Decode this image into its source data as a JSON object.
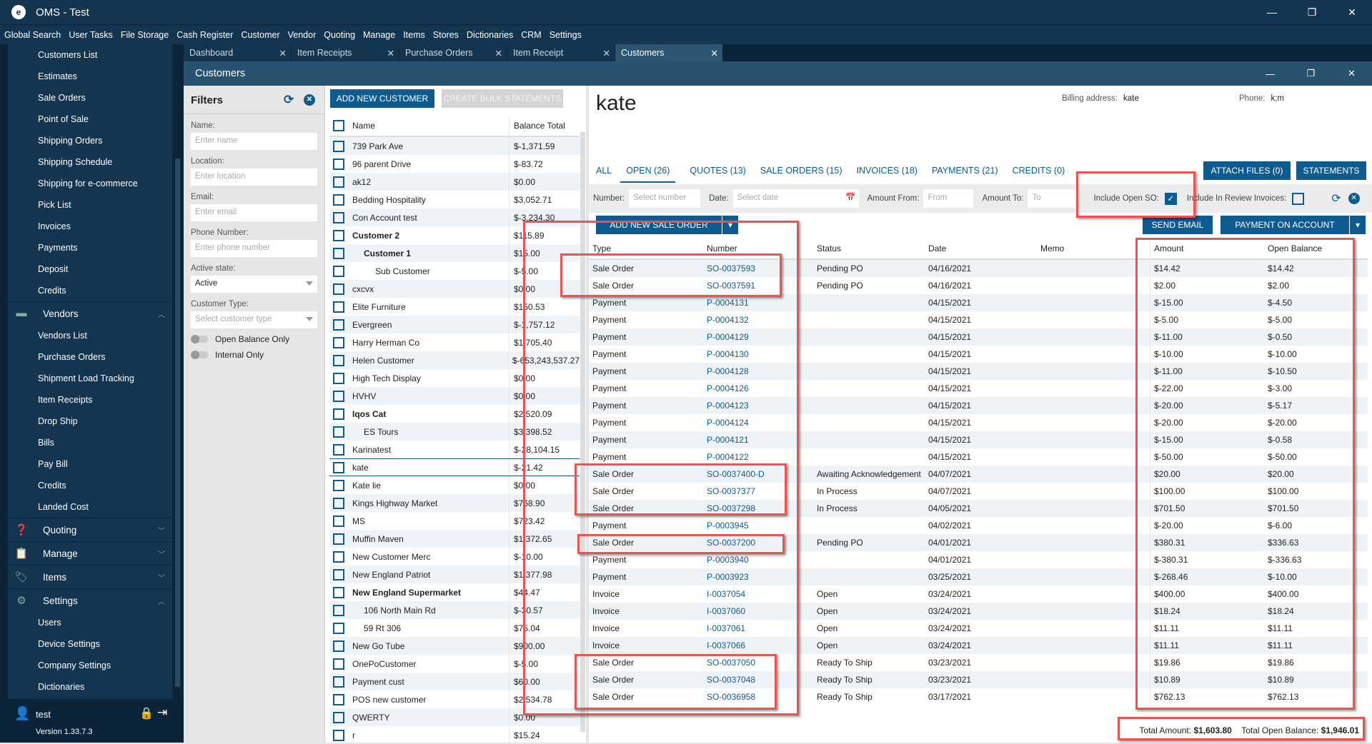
{
  "app": {
    "title": "OMS - Test",
    "controls": [
      "—",
      "❐",
      "✕"
    ]
  },
  "menu": [
    "Global Search",
    "User Tasks",
    "File Storage",
    "Cash Register",
    "Customer",
    "Vendor",
    "Quoting",
    "Manage",
    "Items",
    "Stores",
    "Dictionaries",
    "CRM",
    "Settings"
  ],
  "sidebar": {
    "customer_items": [
      "Customers List",
      "Estimates",
      "Sale Orders",
      "Point of Sale",
      "Shipping Orders",
      "Shipping Schedule",
      "Shipping for e-commerce",
      "Pick List",
      "Invoices",
      "Payments",
      "Deposit",
      "Credits"
    ],
    "vendors": {
      "label": "Vendors",
      "icon": "store-icon",
      "items": [
        "Vendors List",
        "Purchase Orders",
        "Shipment Load Tracking",
        "Item Receipts",
        "Drop Ship",
        "Bills",
        "Pay Bill",
        "Credits",
        "Landed Cost"
      ]
    },
    "groups": [
      {
        "label": "Quoting",
        "icon": "clipboard-question-icon"
      },
      {
        "label": "Manage",
        "icon": "clipboard-list-icon"
      },
      {
        "label": "Items",
        "icon": "tag-icon"
      }
    ],
    "settings": {
      "label": "Settings",
      "icon": "gear-icon",
      "items": [
        "Users",
        "Device Settings",
        "Company Settings",
        "Dictionaries"
      ]
    },
    "user": "test",
    "version": "Version 1.33.7.3"
  },
  "tabs": [
    {
      "label": "Dashboard"
    },
    {
      "label": "Item Receipts"
    },
    {
      "label": "Purchase Orders"
    },
    {
      "label": "Item Receipt"
    },
    {
      "label": "Customers",
      "active": true
    }
  ],
  "window_title": "Customers",
  "filters": {
    "title": "Filters",
    "name_label": "Name:",
    "name_ph": "Enter name",
    "location_label": "Location:",
    "location_ph": "Enter location",
    "email_label": "Email:",
    "email_ph": "Enter email",
    "phone_label": "Phone Number:",
    "phone_ph": "Enter phone number",
    "active_label": "Active state:",
    "active_value": "Active",
    "type_label": "Customer Type:",
    "type_ph": "Select customer type",
    "open_balance": "Open Balance Only",
    "internal": "Internal Only"
  },
  "customers": {
    "add": "ADD NEW CUSTOMER",
    "bulk": "CREATE BULK STATEMENTS",
    "col_name": "Name",
    "col_balance": "Balance Total",
    "rows": [
      [
        "739 Park Ave",
        "$-1,371.59",
        0,
        0
      ],
      [
        "96 parent Drive",
        "$-83.72",
        0,
        0
      ],
      [
        "ak12",
        "$0.00",
        0,
        0
      ],
      [
        "Bedding Hospitality",
        "$3,052.71",
        0,
        0
      ],
      [
        "Con Account test",
        "$-3,234.30",
        0,
        0
      ],
      [
        "Customer 2",
        "$115.89",
        0,
        1
      ],
      [
        "Customer 1",
        "$15.00",
        1,
        1
      ],
      [
        "Sub Customer",
        "$-5.00",
        2,
        0
      ],
      [
        "cxcvx",
        "$0.00",
        0,
        0
      ],
      [
        "Elite Furniture",
        "$150.53",
        0,
        0
      ],
      [
        "Evergreen",
        "$-1,757.12",
        0,
        0
      ],
      [
        "Harry Herman Co",
        "$1,705.40",
        0,
        0
      ],
      [
        "Helen Customer",
        "$-653,243,537.27",
        0,
        0
      ],
      [
        "High Tech Display",
        "$0.00",
        0,
        0
      ],
      [
        "HVHV",
        "$0.00",
        0,
        0
      ],
      [
        "Iqos Cat",
        "$2,520.09",
        0,
        1
      ],
      [
        "ES Tours",
        "$3,398.52",
        1,
        0
      ],
      [
        "Karinatest",
        "$-28,104.15",
        0,
        0
      ],
      [
        "kate",
        "$-21.42",
        0,
        0
      ],
      [
        "Kate lie",
        "$0.00",
        0,
        0
      ],
      [
        "Kings Highway Market",
        "$768.90",
        0,
        0
      ],
      [
        "MS",
        "$723.42",
        0,
        0
      ],
      [
        "Muffin Maven",
        "$1,372.65",
        0,
        0
      ],
      [
        "New Customer Merc",
        "$-10.00",
        0,
        0
      ],
      [
        "New England Patriot",
        "$1,377.98",
        0,
        0
      ],
      [
        "New England Supermarket",
        "$44.47",
        0,
        1
      ],
      [
        "106 North Main Rd",
        "$-30.57",
        1,
        0
      ],
      [
        "59 Rt 306",
        "$75.04",
        1,
        0
      ],
      [
        "New Go Tube",
        "$900.00",
        0,
        0
      ],
      [
        "OnePoCustomer",
        "$-5.00",
        0,
        0
      ],
      [
        "Payment cust",
        "$60.00",
        0,
        0
      ],
      [
        "POS new customer",
        "$2,534.78",
        0,
        0
      ],
      [
        "QWERTY",
        "$0.00",
        0,
        0
      ],
      [
        "r",
        "$15.24",
        0,
        0
      ]
    ],
    "selected": "kate"
  },
  "detail": {
    "name": "kate",
    "billing_label": "Billing address:",
    "billing": "kate",
    "phone_label": "Phone:",
    "phone": "k;m",
    "tabs": [
      {
        "label": "ALL"
      },
      {
        "label": "OPEN (26)",
        "active": true
      },
      {
        "label": "QUOTES (13)"
      },
      {
        "label": "SALE ORDERS (15)"
      },
      {
        "label": "INVOICES (18)"
      },
      {
        "label": "PAYMENTS (21)"
      },
      {
        "label": "CREDITS (0)"
      }
    ],
    "attach": "ATTACH FILES (0)",
    "statements": "STATEMENTS",
    "filter": {
      "number_label": "Number:",
      "number_ph": "Select number",
      "date_label": "Date:",
      "date_ph": "Select date",
      "from_label": "Amount From:",
      "from_ph": "From",
      "to_label": "Amount To:",
      "to_ph": "To",
      "open_so_label": "Include Open SO:",
      "open_so": true,
      "review_label": "Include In Review Invoices:",
      "review": false
    },
    "add_so": "ADD NEW SALE ORDER",
    "send_email": "SEND EMAIL",
    "payment": "PAYMENT ON ACCOUNT",
    "columns": [
      "Type",
      "Number",
      "Status",
      "Date",
      "Memo",
      "Amount",
      "Open Balance"
    ],
    "rows": [
      [
        "Sale Order",
        "SO-0037593",
        "Pending PO",
        "04/16/2021",
        "",
        "$14.42",
        "$14.42"
      ],
      [
        "Sale Order",
        "SO-0037591",
        "Pending PO",
        "04/16/2021",
        "",
        "$2.00",
        "$2.00"
      ],
      [
        "Payment",
        "P-0004131",
        "",
        "04/15/2021",
        "",
        "$-15.00",
        "$-4.50"
      ],
      [
        "Payment",
        "P-0004132",
        "",
        "04/15/2021",
        "",
        "$-5.00",
        "$-5.00"
      ],
      [
        "Payment",
        "P-0004129",
        "",
        "04/15/2021",
        "",
        "$-11.00",
        "$-0.50"
      ],
      [
        "Payment",
        "P-0004130",
        "",
        "04/15/2021",
        "",
        "$-10.00",
        "$-10.00"
      ],
      [
        "Payment",
        "P-0004128",
        "",
        "04/15/2021",
        "",
        "$-11.00",
        "$-10.50"
      ],
      [
        "Payment",
        "P-0004126",
        "",
        "04/15/2021",
        "",
        "$-22.00",
        "$-3.00"
      ],
      [
        "Payment",
        "P-0004123",
        "",
        "04/15/2021",
        "",
        "$-20.00",
        "$-5.17"
      ],
      [
        "Payment",
        "P-0004124",
        "",
        "04/15/2021",
        "",
        "$-20.00",
        "$-20.00"
      ],
      [
        "Payment",
        "P-0004121",
        "",
        "04/15/2021",
        "",
        "$-15.00",
        "$-0.58"
      ],
      [
        "Payment",
        "P-0004122",
        "",
        "04/15/2021",
        "",
        "$-50.00",
        "$-50.00"
      ],
      [
        "Sale Order",
        "SO-0037400-D",
        "Awaiting Acknowledgement",
        "04/07/2021",
        "",
        "$20.00",
        "$20.00"
      ],
      [
        "Sale Order",
        "SO-0037377",
        "In Process",
        "04/07/2021",
        "",
        "$100.00",
        "$100.00"
      ],
      [
        "Sale Order",
        "SO-0037298",
        "In Process",
        "04/05/2021",
        "",
        "$701.50",
        "$701.50"
      ],
      [
        "Payment",
        "P-0003945",
        "",
        "04/02/2021",
        "",
        "$-20.00",
        "$-6.00"
      ],
      [
        "Sale Order",
        "SO-0037200",
        "Pending PO",
        "04/01/2021",
        "",
        "$380.31",
        "$336.63"
      ],
      [
        "Payment",
        "P-0003940",
        "",
        "04/01/2021",
        "",
        "$-380.31",
        "$-336.63"
      ],
      [
        "Payment",
        "P-0003923",
        "",
        "03/25/2021",
        "",
        "$-268.46",
        "$-10.00"
      ],
      [
        "Invoice",
        "I-0037054",
        "Open",
        "03/24/2021",
        "",
        "$400.00",
        "$400.00"
      ],
      [
        "Invoice",
        "I-0037060",
        "Open",
        "03/24/2021",
        "",
        "$18.24",
        "$18.24"
      ],
      [
        "Invoice",
        "I-0037061",
        "Open",
        "03/24/2021",
        "",
        "$11.11",
        "$11.11"
      ],
      [
        "Invoice",
        "I-0037066",
        "Open",
        "03/24/2021",
        "",
        "$11.11",
        "$11.11"
      ],
      [
        "Sale Order",
        "SO-0037050",
        "Ready To Ship",
        "03/23/2021",
        "",
        "$19.86",
        "$19.86"
      ],
      [
        "Sale Order",
        "SO-0037048",
        "Ready To Ship",
        "03/23/2021",
        "",
        "$10.89",
        "$10.89"
      ],
      [
        "Sale Order",
        "SO-0036958",
        "Ready To Ship",
        "03/17/2021",
        "",
        "$762.13",
        "$762.13"
      ]
    ],
    "total_amount_label": "Total Amount:",
    "total_amount": "$1,603.80",
    "total_open_label": "Total Open Balance:",
    "total_open": "$1,946.01"
  },
  "colors": {
    "accent": "#0e5b8f",
    "nav": "#14354f",
    "highlight": "#ef5350"
  }
}
